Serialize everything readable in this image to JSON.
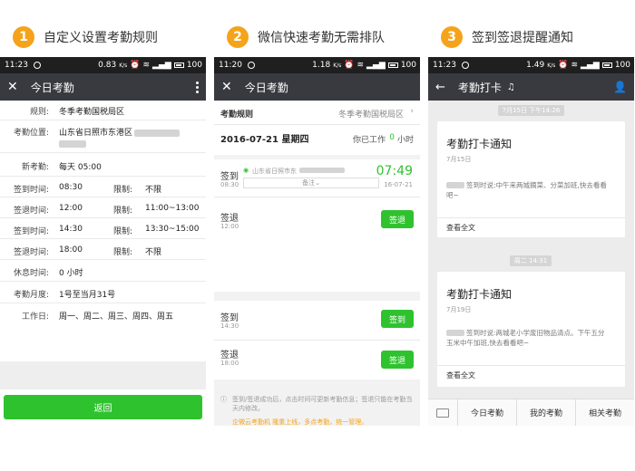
{
  "steps": [
    {
      "num": "1",
      "caption": "自定义设置考勤规则"
    },
    {
      "num": "2",
      "caption": "微信快速考勤无需排队"
    },
    {
      "num": "3",
      "caption": "签到签退提醒通知"
    }
  ],
  "screen1": {
    "status": {
      "time": "11:23",
      "net": "0.83",
      "unit": "K/s",
      "battery": "100"
    },
    "nav_title": "今日考勤",
    "rows": [
      {
        "label": "规则:",
        "value": "冬季考勤国税局区"
      },
      {
        "label": "考勤位置:",
        "value": "山东省日照市东港区"
      },
      {
        "label": "新考勤:",
        "value": "每天 05:00"
      },
      {
        "label": "签到时间:",
        "value": "08:30",
        "sub_label": "限制:",
        "sub_value": "不限"
      },
      {
        "label": "签退时间:",
        "value": "12:00",
        "sub_label": "限制:",
        "sub_value": "11:00~13:00"
      },
      {
        "label": "签到时间:",
        "value": "14:30",
        "sub_label": "限制:",
        "sub_value": "13:30~15:00"
      },
      {
        "label": "签退时间:",
        "value": "18:00",
        "sub_label": "限制:",
        "sub_value": "不限"
      },
      {
        "label": "休息时间:",
        "value": "0 小时"
      },
      {
        "label": "考勤月度:",
        "value": "1号至当月31号"
      },
      {
        "label": "工作日:",
        "value": "周一、周二、周三、周四、周五"
      }
    ],
    "back_label": "返回"
  },
  "screen2": {
    "status": {
      "time": "11:20",
      "net": "1.18",
      "unit": "K/s",
      "battery": "100"
    },
    "nav_title": "今日考勤",
    "rule_label": "考勤规则",
    "rule_value": "冬季考勤国税局区",
    "date": "2016-07-21 星期四",
    "work_prefix": "你已工作",
    "work_value": "0",
    "work_unit": "小时",
    "checkin_label": "签到",
    "checkin_time": "08:30",
    "checkin_loc": "山东省日照市东",
    "checkin_clock": "07:49",
    "checkin_date": "16-07-21",
    "remark_placeholder": "备注",
    "slots": [
      {
        "label": "签退",
        "time": "12:00",
        "button": "签退"
      },
      {
        "label": "签到",
        "time": "14:30",
        "button": "签到"
      },
      {
        "label": "签退",
        "time": "18:00",
        "button": "签退"
      }
    ],
    "info_text": "签到/签退成功后，点击时间可更新考勤信息；签退只能在考勤当天内修改。",
    "promo_text": "企微云考勤机 隆重上线，多点考勤，统一管理。"
  },
  "screen3": {
    "status": {
      "time": "11:23",
      "net": "1.49",
      "unit": "K/s",
      "battery": "100"
    },
    "nav_title": "考勤打卡",
    "notices": [
      {
        "stamp": "7月15日 下午14:26",
        "title": "考勤打卡通知",
        "date": "7月15日",
        "body": "签到时说:中午来两城摘菜、分菜加班,快去看看吧~",
        "more": "查看全文"
      },
      {
        "stamp": "周二 14:31",
        "title": "考勤打卡通知",
        "date": "7月19日",
        "body": "签到时说:两城老小学废旧物品清点。下午五分玉米中午加班,快去看看吧~",
        "more": "查看全文"
      }
    ],
    "tabs": [
      "今日考勤",
      "我的考勤",
      "相关考勤"
    ]
  },
  "colors": {
    "accent": "#f5a31a",
    "green": "#2fc22f",
    "navbar": "#393a3f",
    "statusbar": "#1f1f1f"
  }
}
